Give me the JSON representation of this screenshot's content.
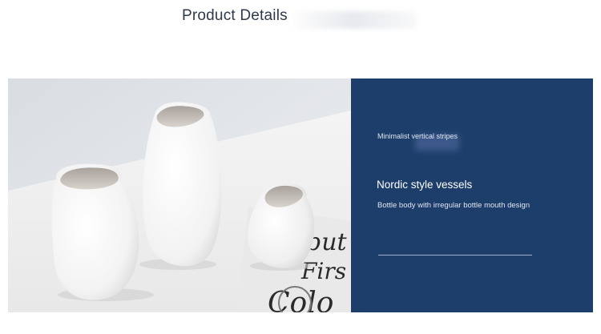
{
  "header": {
    "title": "Product Details"
  },
  "photo": {
    "subject": "vase-photo",
    "magazine_text": [
      "but",
      "Firs",
      "Colo"
    ]
  },
  "panel": {
    "background_color": "#1d3e6a",
    "tagline": "Minimalist vertical stripes",
    "title": "Nordic style vessels",
    "description": "Bottle body with irregular bottle mouth design"
  }
}
